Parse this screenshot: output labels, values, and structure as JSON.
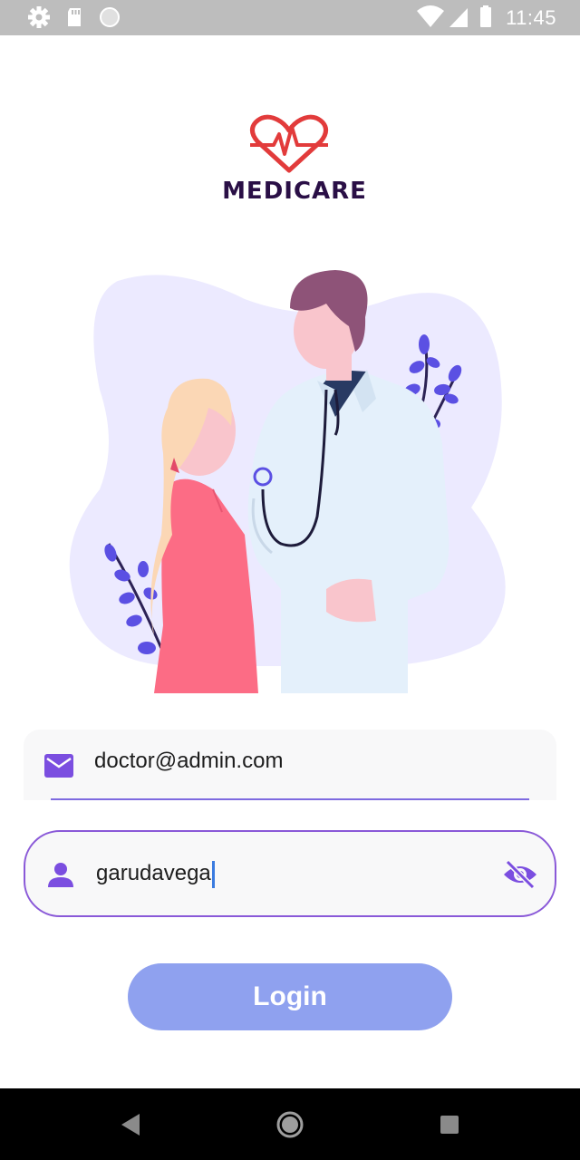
{
  "status_bar": {
    "time": "11:45",
    "left_icons": [
      "settings-icon",
      "sd-card-icon",
      "circle-icon"
    ],
    "right_icons": [
      "wifi-icon",
      "signal-icon",
      "battery-icon"
    ]
  },
  "logo": {
    "text": "MEDICARE",
    "brand_color": "#e74c3c",
    "text_color": "#2a0f46"
  },
  "illustration": {
    "subject": "doctor-with-stethoscope-and-patient"
  },
  "login_form": {
    "email": {
      "value": "doctor@admin.com",
      "icon": "email-icon"
    },
    "password": {
      "value": "garudavega",
      "icon": "person-icon",
      "toggle_icon": "visibility-off-icon"
    },
    "login_label": "Login",
    "accent_color": "#7b4ee0",
    "button_color": "#8fa1ef"
  },
  "nav_bar": {
    "buttons": [
      "back-icon",
      "home-icon",
      "recents-icon"
    ]
  }
}
